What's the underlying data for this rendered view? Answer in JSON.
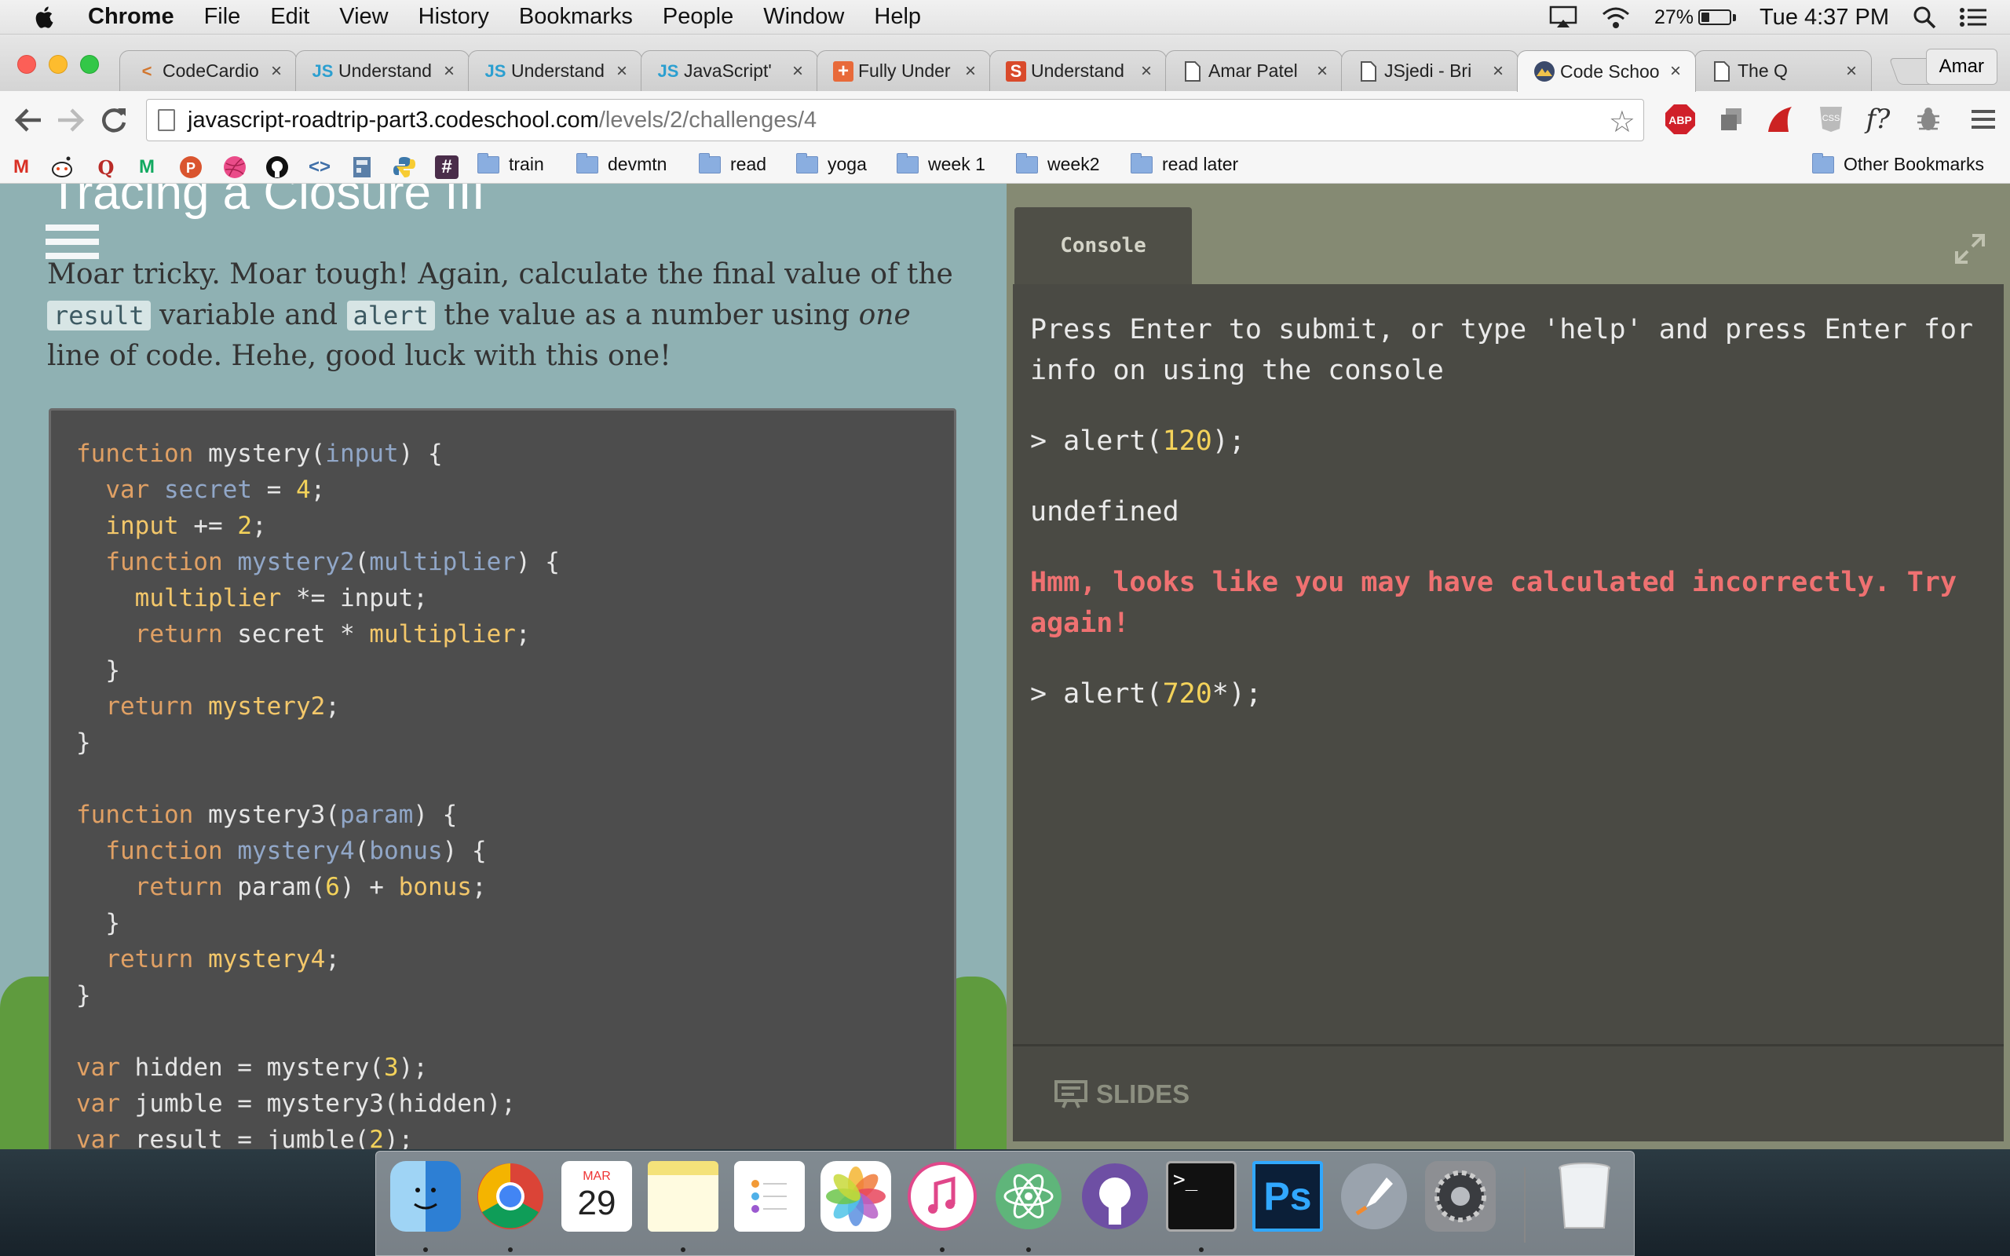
{
  "menubar": {
    "app": "Chrome",
    "items": [
      "File",
      "Edit",
      "View",
      "History",
      "Bookmarks",
      "People",
      "Window",
      "Help"
    ],
    "battery": "27%",
    "battery_level": 0.27,
    "clock": "Tue 4:37 PM"
  },
  "tabs": [
    {
      "title": "CodeCardio",
      "icon": "code-icon"
    },
    {
      "title": "Understand",
      "icon": "js-icon"
    },
    {
      "title": "Understand",
      "icon": "js-icon"
    },
    {
      "title": "JavaScript'",
      "icon": "js-icon"
    },
    {
      "title": "Fully Under",
      "icon": "plus-icon"
    },
    {
      "title": "Understand",
      "icon": "s-logo-icon"
    },
    {
      "title": "Amar Patel",
      "icon": "page-icon"
    },
    {
      "title": "JSjedi - Bri",
      "icon": "page-icon"
    },
    {
      "title": "Code Schoo",
      "icon": "codeschool-icon"
    },
    {
      "title": "The Q",
      "icon": "page-icon"
    }
  ],
  "profile": "Amar",
  "url": {
    "host": "javascript-roadtrip-part3.codeschool.com",
    "path": "/levels/2/challenges/4"
  },
  "bookmarks": {
    "folders": [
      "train",
      "devmtn",
      "read",
      "yoga",
      "week 1",
      "week2",
      "read later"
    ],
    "other": "Other Bookmarks"
  },
  "challenge": {
    "heading": "Tracing a Closure III",
    "intro_1": "Moar tricky. Moar tough! Again, calculate the final value of the",
    "chip_result": "result",
    "intro_2": "variable and",
    "chip_alert": "alert",
    "intro_3": "the value as a number using",
    "intro_em": "one",
    "intro_4": "line of code. Hehe, good luck with this one!"
  },
  "console": {
    "tab_label": "Console",
    "help": "Press Enter to submit, or type 'help' and press Enter for info on using the console",
    "cmd1_prefix": "> alert(",
    "cmd1_num": "120",
    "cmd1_suffix": ");",
    "result1": "undefined",
    "error": "Hmm, looks like you may have calculated incorrectly. Try again!",
    "cmd2_prefix": "> alert(",
    "cmd2_num": "720",
    "cmd2_suffix": "*);",
    "slides_label": "SLIDES"
  },
  "dock": {
    "calendar_month": "MAR",
    "calendar_day": "29"
  }
}
